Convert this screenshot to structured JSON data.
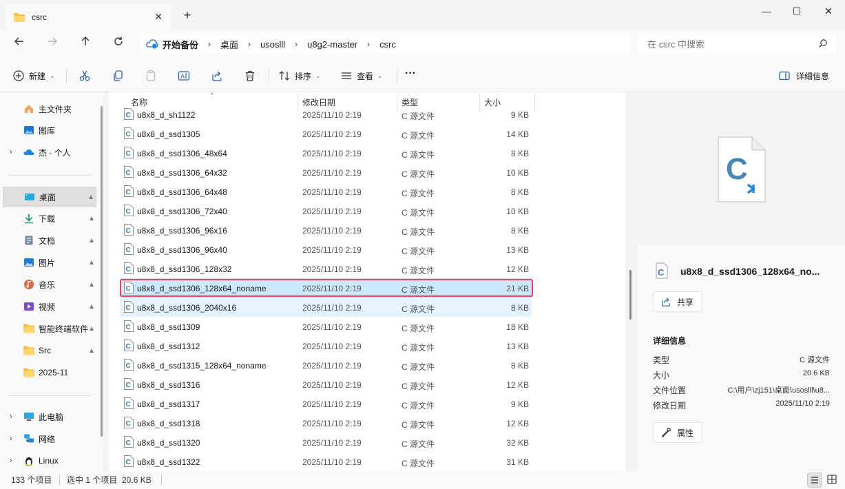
{
  "window": {
    "tab_title": "csrc",
    "new_tab": "+",
    "close_tab": "✕",
    "minimize": "—",
    "maximize": "☐",
    "close": "✕"
  },
  "address": {
    "home": "开始备份",
    "crumbs": [
      "桌面",
      "usoslll",
      "u8g2-master",
      "csrc"
    ],
    "search_placeholder": "在 csrc 中搜索"
  },
  "toolbar": {
    "new_label": "新建",
    "sort_label": "排序",
    "view_label": "查看",
    "more_label": "···",
    "details_label": "详细信息"
  },
  "sidebar": {
    "items": [
      {
        "label": "主文件夹",
        "icon": "home-icon"
      },
      {
        "label": "图库",
        "icon": "gallery-icon"
      },
      {
        "label": "杰 - 个人",
        "icon": "onedrive-icon"
      },
      {
        "label": "桌面",
        "icon": "desktop-icon"
      },
      {
        "label": "下载",
        "icon": "download-icon"
      },
      {
        "label": "文档",
        "icon": "documents-icon"
      },
      {
        "label": "图片",
        "icon": "pictures-icon"
      },
      {
        "label": "音乐",
        "icon": "music-icon"
      },
      {
        "label": "视频",
        "icon": "videos-icon"
      },
      {
        "label": "智能终端软件",
        "icon": "folder-icon"
      },
      {
        "label": "Src",
        "icon": "folder-icon"
      },
      {
        "label": "2025-11",
        "icon": "folder-icon"
      },
      {
        "label": "此电脑",
        "icon": "computer-icon"
      },
      {
        "label": "网络",
        "icon": "network-icon"
      },
      {
        "label": "Linux",
        "icon": "linux-icon"
      }
    ],
    "chevron": "›",
    "pin": "📌"
  },
  "columns": {
    "name": "名称",
    "date": "修改日期",
    "type": "类型",
    "size": "大小"
  },
  "files": [
    {
      "name": "u8x8_d_sh1122",
      "date": "2025/11/10 2:19",
      "type": "C 源文件",
      "size": "9 KB"
    },
    {
      "name": "u8x8_d_ssd1305",
      "date": "2025/11/10 2:19",
      "type": "C 源文件",
      "size": "14 KB"
    },
    {
      "name": "u8x8_d_ssd1306_48x64",
      "date": "2025/11/10 2:19",
      "type": "C 源文件",
      "size": "8 KB"
    },
    {
      "name": "u8x8_d_ssd1306_64x32",
      "date": "2025/11/10 2:19",
      "type": "C 源文件",
      "size": "10 KB"
    },
    {
      "name": "u8x8_d_ssd1306_64x48",
      "date": "2025/11/10 2:19",
      "type": "C 源文件",
      "size": "8 KB"
    },
    {
      "name": "u8x8_d_ssd1306_72x40",
      "date": "2025/11/10 2:19",
      "type": "C 源文件",
      "size": "10 KB"
    },
    {
      "name": "u8x8_d_ssd1306_96x16",
      "date": "2025/11/10 2:19",
      "type": "C 源文件",
      "size": "8 KB"
    },
    {
      "name": "u8x8_d_ssd1306_96x40",
      "date": "2025/11/10 2:19",
      "type": "C 源文件",
      "size": "13 KB"
    },
    {
      "name": "u8x8_d_ssd1306_128x32",
      "date": "2025/11/10 2:19",
      "type": "C 源文件",
      "size": "12 KB"
    },
    {
      "name": "u8x8_d_ssd1306_128x64_noname",
      "date": "2025/11/10 2:19",
      "type": "C 源文件",
      "size": "21 KB"
    },
    {
      "name": "u8x8_d_ssd1306_2040x16",
      "date": "2025/11/10 2:19",
      "type": "C 源文件",
      "size": "8 KB"
    },
    {
      "name": "u8x8_d_ssd1309",
      "date": "2025/11/10 2:19",
      "type": "C 源文件",
      "size": "18 KB"
    },
    {
      "name": "u8x8_d_ssd1312",
      "date": "2025/11/10 2:19",
      "type": "C 源文件",
      "size": "13 KB"
    },
    {
      "name": "u8x8_d_ssd1315_128x64_noname",
      "date": "2025/11/10 2:19",
      "type": "C 源文件",
      "size": "8 KB"
    },
    {
      "name": "u8x8_d_ssd1316",
      "date": "2025/11/10 2:19",
      "type": "C 源文件",
      "size": "12 KB"
    },
    {
      "name": "u8x8_d_ssd1317",
      "date": "2025/11/10 2:19",
      "type": "C 源文件",
      "size": "9 KB"
    },
    {
      "name": "u8x8_d_ssd1318",
      "date": "2025/11/10 2:19",
      "type": "C 源文件",
      "size": "12 KB"
    },
    {
      "name": "u8x8_d_ssd1320",
      "date": "2025/11/10 2:19",
      "type": "C 源文件",
      "size": "32 KB"
    },
    {
      "name": "u8x8_d_ssd1322",
      "date": "2025/11/10 2:19",
      "type": "C 源文件",
      "size": "31 KB"
    }
  ],
  "details": {
    "title": "u8x8_d_ssd1306_128x64_no...",
    "share_label": "共享",
    "section_title": "详细信息",
    "rows": [
      {
        "key": "类型",
        "value": "C 源文件"
      },
      {
        "key": "大小",
        "value": "20.6 KB"
      },
      {
        "key": "文件位置",
        "value": "C:\\用户\\zj151\\桌面\\usoslll\\u8..."
      },
      {
        "key": "修改日期",
        "value": "2025/11/10 2:19"
      }
    ],
    "properties_label": "属性"
  },
  "status": {
    "count": "133 个项目",
    "selected": "选中 1 个项目  20.6 KB"
  },
  "colors": {
    "selected_row": "#cce8ff",
    "highlight_box": "#e0485f",
    "c_icon": "#3a7ab8"
  }
}
